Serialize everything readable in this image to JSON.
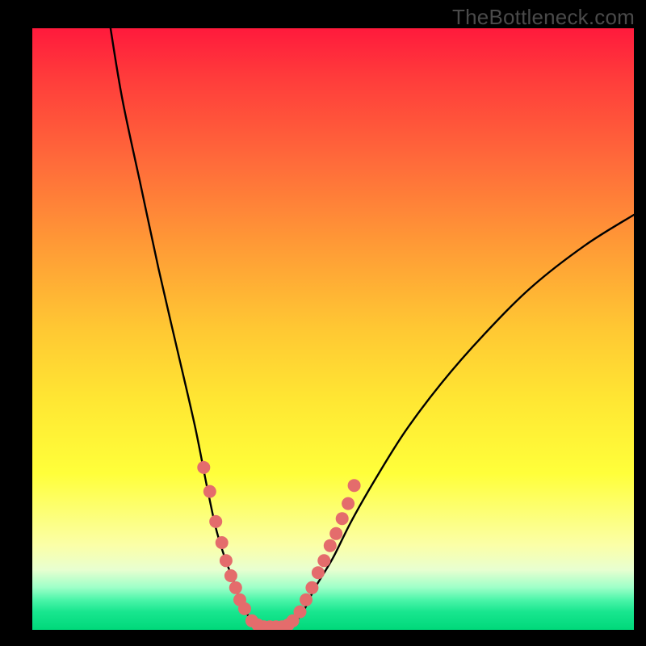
{
  "watermark": "TheBottleneck.com",
  "colors": {
    "gradient_top": "#ff1a3c",
    "gradient_mid": "#ffe733",
    "gradient_bottom": "#00d87a",
    "curve": "#000000",
    "points": "#e46c6c",
    "frame": "#000000"
  },
  "chart_data": {
    "type": "line",
    "title": "",
    "xlabel": "",
    "ylabel": "",
    "xlim": [
      0,
      100
    ],
    "ylim": [
      0,
      100
    ],
    "note": "x and y in percent of plot area; y=100 top, y=0 bottom",
    "series": [
      {
        "name": "curve-left",
        "x": [
          13,
          15,
          18,
          21,
          24,
          27,
          29,
          30.5,
          32,
          33.5,
          34.5,
          35.8,
          37
        ],
        "y": [
          100,
          88,
          74,
          60,
          47,
          34,
          24,
          17,
          12,
          8,
          5,
          2.5,
          0.5
        ]
      },
      {
        "name": "curve-floor",
        "x": [
          37,
          39,
          41,
          43
        ],
        "y": [
          0.5,
          0.3,
          0.3,
          0.5
        ]
      },
      {
        "name": "curve-right",
        "x": [
          43,
          45,
          47,
          50,
          53,
          57,
          62,
          68,
          75,
          83,
          92,
          100
        ],
        "y": [
          0.5,
          3,
          7,
          12,
          18,
          25,
          33,
          41,
          49,
          57,
          64,
          69
        ]
      }
    ],
    "points": {
      "name": "markers",
      "x": [
        28.5,
        29.5,
        30.5,
        31.5,
        32.2,
        33,
        33.8,
        34.5,
        35.3,
        36.5,
        37.5,
        38.5,
        39.5,
        40.5,
        41.5,
        42.5,
        43.3,
        44.5,
        45.5,
        46.5,
        47.5,
        48.5,
        49.5,
        50.5,
        51.5,
        52.5,
        53.5
      ],
      "y": [
        27,
        23,
        18,
        14.5,
        11.5,
        9,
        7,
        5,
        3.5,
        1.5,
        0.8,
        0.5,
        0.5,
        0.5,
        0.5,
        0.8,
        1.5,
        3,
        5,
        7,
        9.5,
        11.5,
        14,
        16,
        18.5,
        21,
        24
      ]
    }
  }
}
